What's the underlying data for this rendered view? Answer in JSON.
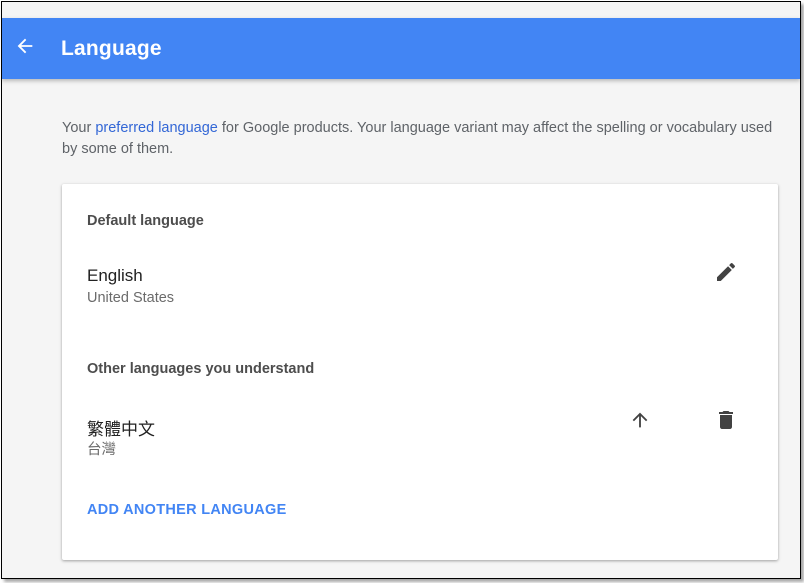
{
  "appbar": {
    "title": "Language",
    "back_icon": "arrow-back-icon",
    "color": "#4285f4"
  },
  "intro": {
    "prefix": "Your ",
    "link": "preferred language",
    "suffix": " for Google products. Your language variant may affect the spelling or vocabulary used by some of them."
  },
  "default_section": {
    "label": "Default language",
    "language": {
      "name": "English",
      "region": "United States",
      "action_icon": "edit-icon"
    }
  },
  "other_section": {
    "label": "Other languages you understand",
    "languages": [
      {
        "name": "繁體中文",
        "region": "台灣",
        "move_icon": "arrow-up-icon",
        "delete_icon": "delete-icon"
      }
    ]
  },
  "add_language_label": "ADD ANOTHER LANGUAGE",
  "colors": {
    "accent": "#4285f4",
    "link": "#3367d6",
    "background": "#f5f5f5"
  }
}
